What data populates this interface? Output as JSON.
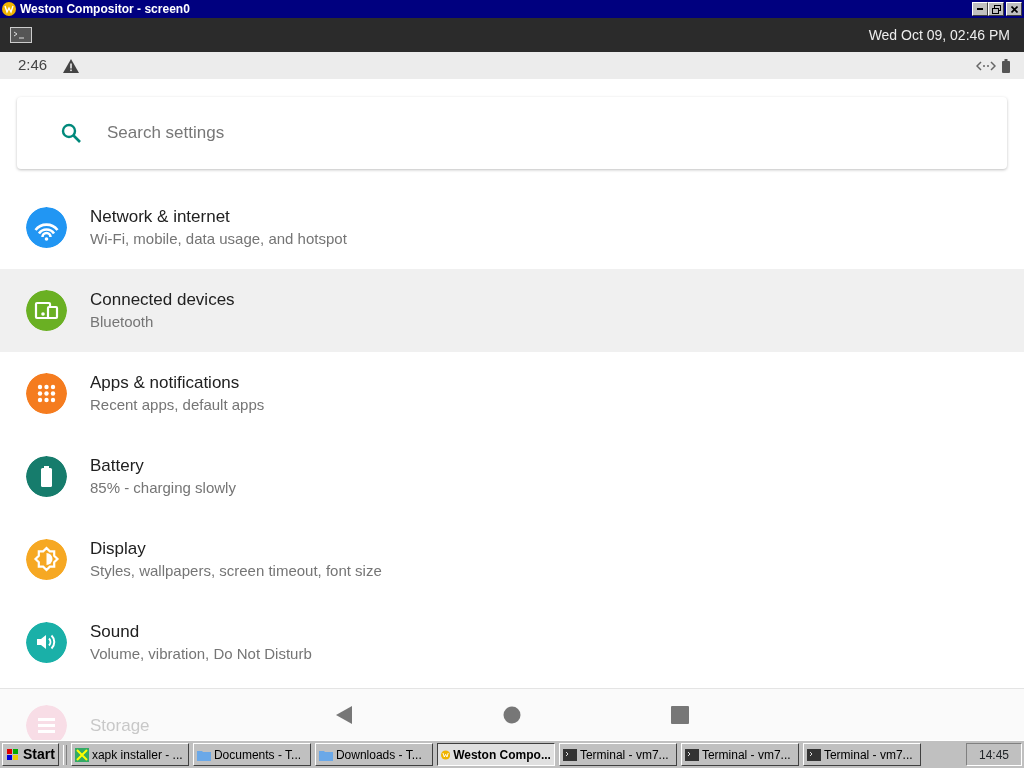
{
  "window": {
    "title": "Weston Compositor - screen0"
  },
  "weston_bar": {
    "clock": "Wed Oct 09, 02:46 PM"
  },
  "status_bar": {
    "time": "2:46"
  },
  "search": {
    "placeholder": "Search settings"
  },
  "settings": [
    {
      "kind": "wifi",
      "title": "Network & internet",
      "subtitle": "Wi-Fi, mobile, data usage, and hotspot",
      "color": "#2196f3",
      "highlighted": false,
      "faded": false
    },
    {
      "kind": "devices",
      "title": "Connected devices",
      "subtitle": "Bluetooth",
      "color": "#6ab023",
      "highlighted": true,
      "faded": false
    },
    {
      "kind": "apps",
      "title": "Apps & notifications",
      "subtitle": "Recent apps, default apps",
      "color": "#f57c1f",
      "highlighted": false,
      "faded": false
    },
    {
      "kind": "battery",
      "title": "Battery",
      "subtitle": "85% - charging slowly",
      "color": "#167c6c",
      "highlighted": false,
      "faded": false
    },
    {
      "kind": "display",
      "title": "Display",
      "subtitle": "Styles, wallpapers, screen timeout, font size",
      "color": "#f6a823",
      "highlighted": false,
      "faded": false
    },
    {
      "kind": "sound",
      "title": "Sound",
      "subtitle": "Volume, vibration, Do Not Disturb",
      "color": "#1ab0a8",
      "highlighted": false,
      "faded": false
    },
    {
      "kind": "storage",
      "title": "Storage",
      "color": "#f8dde6",
      "highlighted": false,
      "faded": true
    }
  ],
  "taskbar": {
    "start": "Start",
    "clock": "14:45",
    "items": [
      {
        "kind": "installer",
        "label": "xapk installer - ...",
        "selected": false
      },
      {
        "kind": "folder",
        "label": "Documents - T...",
        "selected": false
      },
      {
        "kind": "folder",
        "label": "Downloads - T...",
        "selected": false
      },
      {
        "kind": "weston",
        "label": "Weston Compo...",
        "selected": true
      },
      {
        "kind": "terminal",
        "label": "Terminal - vm7...",
        "selected": false
      },
      {
        "kind": "terminal",
        "label": "Terminal - vm7...",
        "selected": false
      },
      {
        "kind": "terminal",
        "label": "Terminal - vm7...",
        "selected": false
      }
    ]
  }
}
